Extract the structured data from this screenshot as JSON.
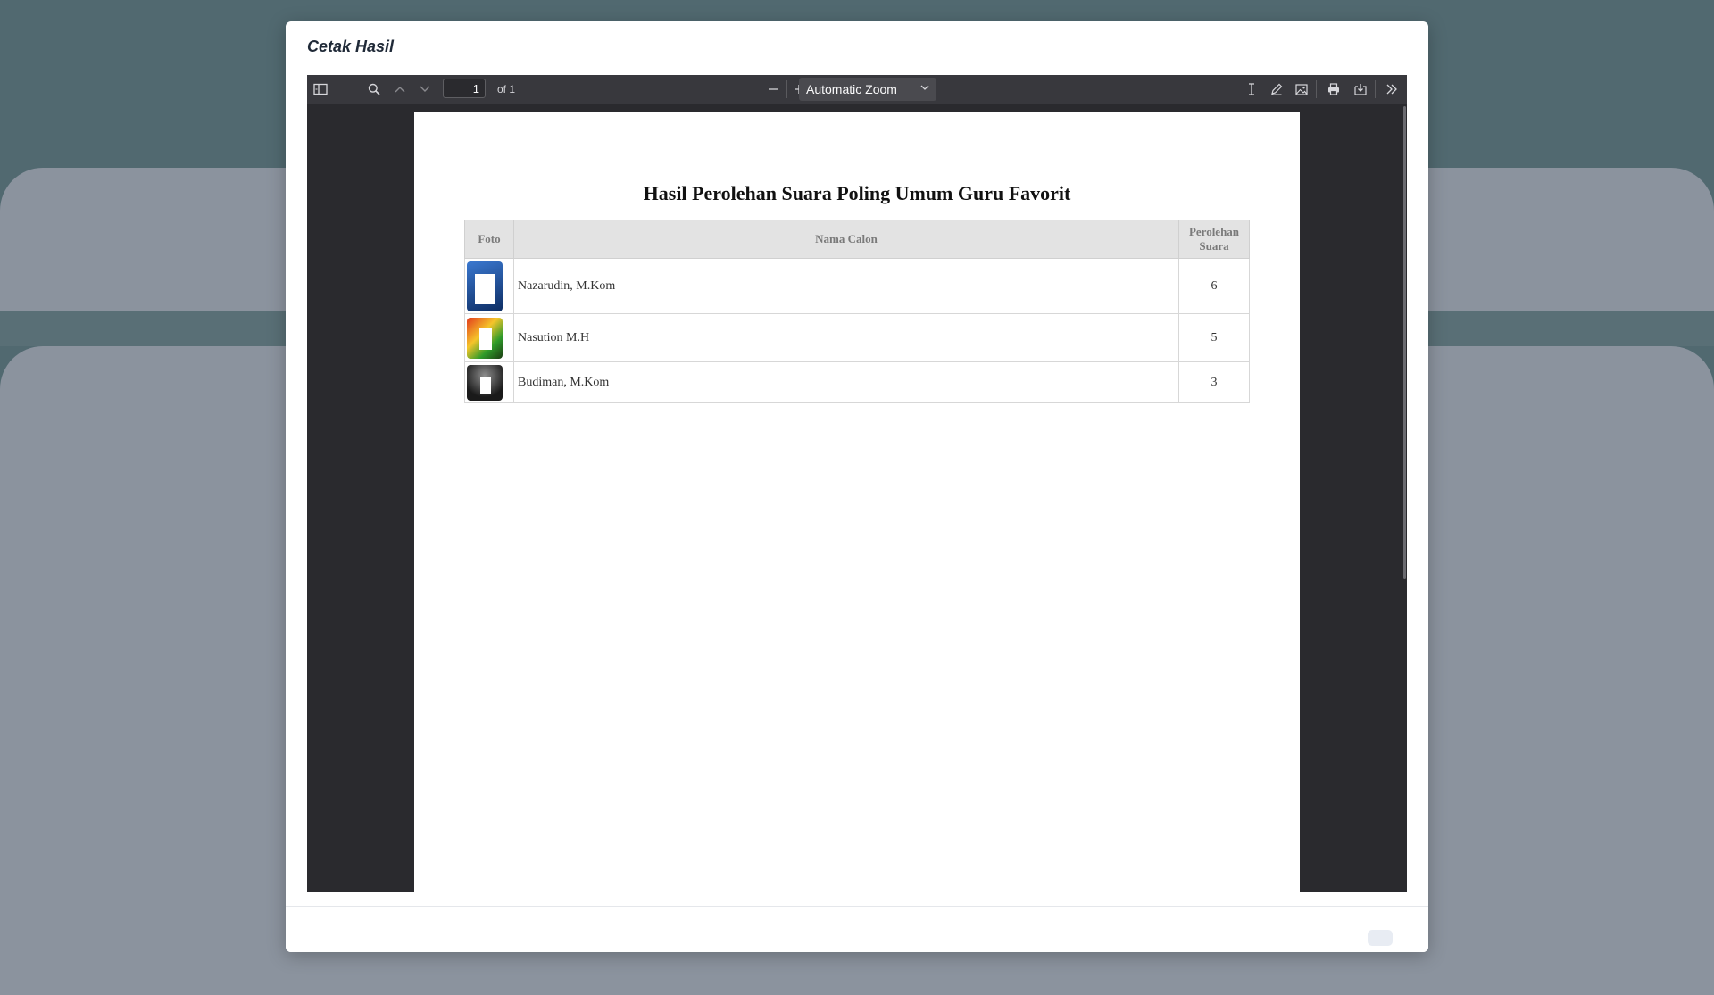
{
  "modal": {
    "title": "Cetak Hasil"
  },
  "viewer": {
    "page_number": "1",
    "page_count": "of 1",
    "zoom": "Automatic Zoom",
    "icons": [
      "sidebar-toggle-icon",
      "search-icon",
      "chevron-up-icon",
      "chevron-down-icon",
      "minus-icon",
      "plus-icon",
      "text-cursor-icon",
      "pencil-icon",
      "image-icon",
      "print-icon",
      "download-icon",
      "double-chevron-right-icon"
    ]
  },
  "document": {
    "title": "Hasil Perolehan Suara Poling Umum Guru Favorit",
    "columns": {
      "photo": "Foto",
      "name": "Nama Calon",
      "votes": "Perolehan Suara"
    },
    "rows": [
      {
        "name": "Nazarudin, M.Kom",
        "votes": "6",
        "photo_colors": [
          "#2a62b8",
          "#0d2d63"
        ]
      },
      {
        "name": "Nasution M.H",
        "votes": "5",
        "photo_colors": [
          "#e0401f",
          "#2f9b2a"
        ]
      },
      {
        "name": "Budiman, M.Kom",
        "votes": "3",
        "photo_colors": [
          "#1a1a1a",
          "#7d7d7d"
        ]
      }
    ]
  },
  "colors": {
    "page_background": "#516970",
    "viewer_background": "#2a2a2e",
    "toolbar_background": "#38383d"
  }
}
